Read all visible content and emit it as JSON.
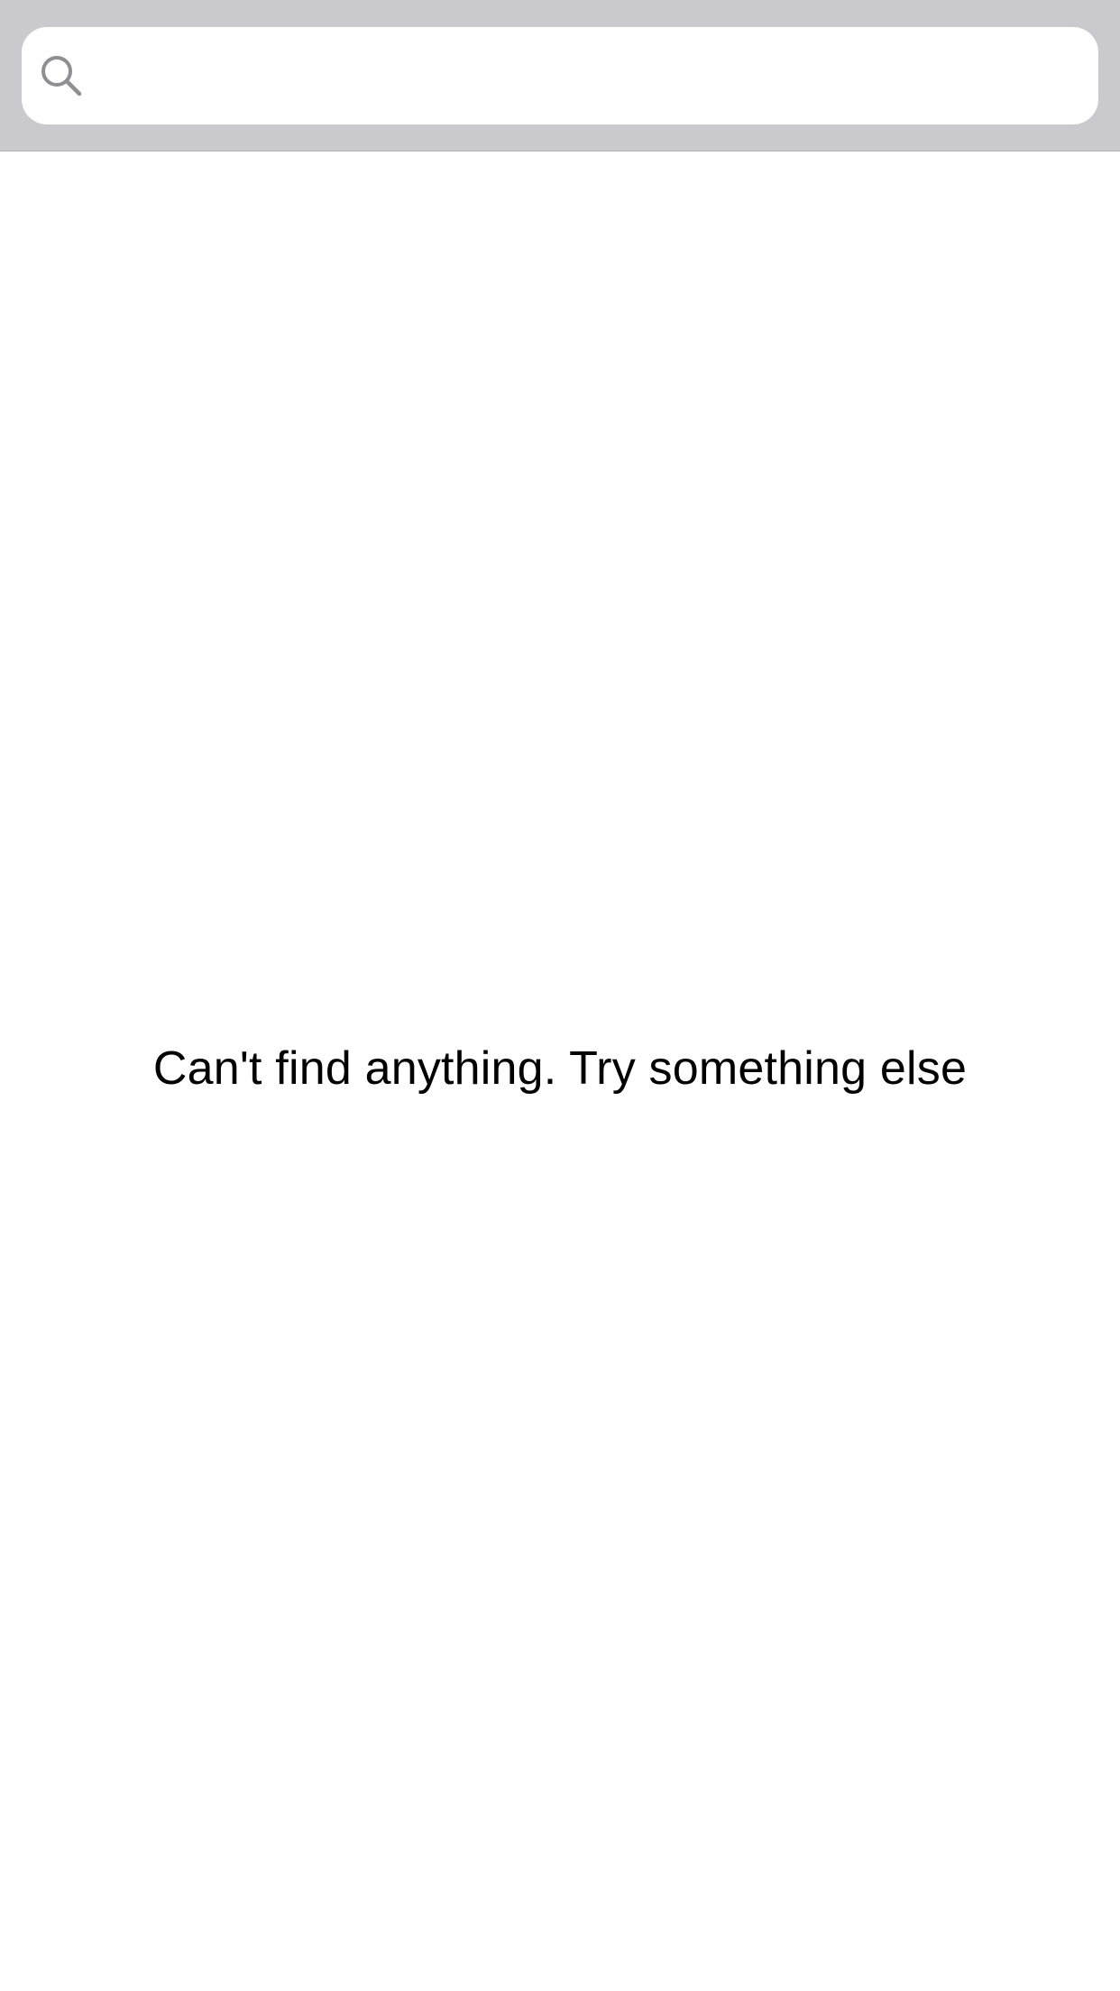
{
  "search": {
    "value": "",
    "placeholder": "",
    "icon": "search-icon",
    "background_color": "#c9c9ce",
    "field_color": "#ffffff"
  },
  "results": {
    "empty_message": "Can't find anything. Try something else"
  }
}
